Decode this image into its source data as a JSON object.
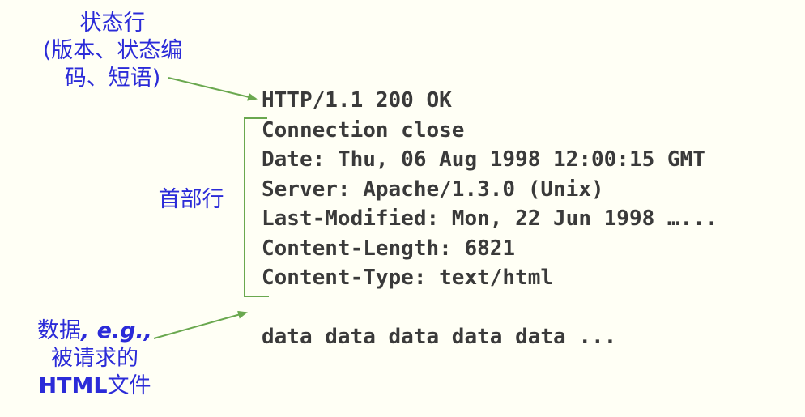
{
  "labels": {
    "status_line": {
      "line1": "状态行",
      "line2": "(版本、状态编",
      "line3": "码、短语)"
    },
    "header_lines": "首部行",
    "data": {
      "line1_cn": "数据",
      "line1_eg": ", e.g.,",
      "line2": "被请求的",
      "line3_html": "HTML",
      "line3_cn": "文件"
    }
  },
  "response": {
    "status_line": "HTTP/1.1 200 OK",
    "headers": [
      "Connection close",
      "Date: Thu, 06 Aug 1998 12:00:15 GMT",
      "Server: Apache/1.3.0 (Unix)",
      "Last-Modified: Mon, 22 Jun 1998 …...",
      "Content-Length: 6821",
      "Content-Type: text/html"
    ],
    "body": "data data data data data ..."
  },
  "colors": {
    "label_text": "#2b2bd8",
    "code_text": "#3a3a3a",
    "arrow": "#6aa84f",
    "background": "#fffff5"
  }
}
